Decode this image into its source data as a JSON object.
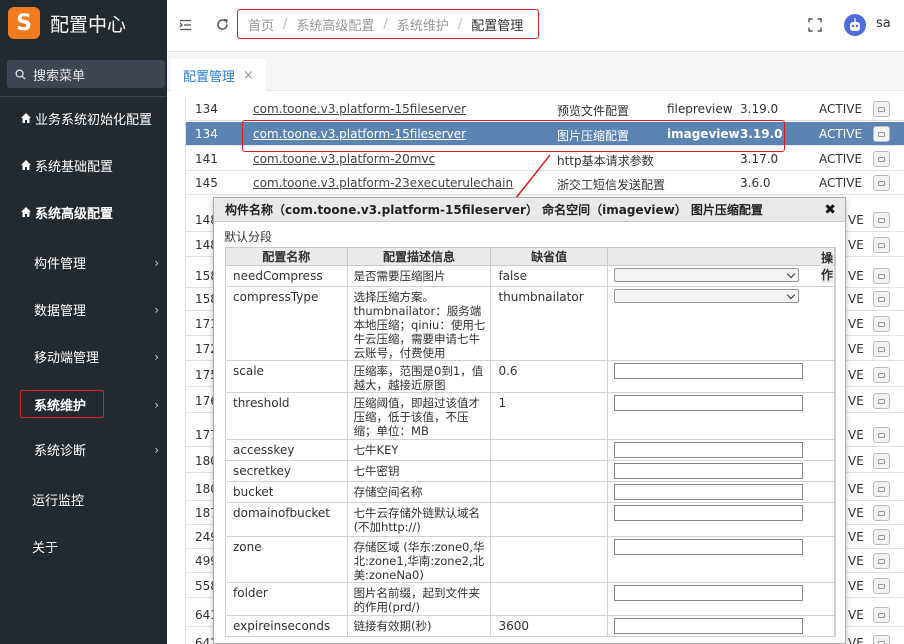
{
  "app": {
    "logo_letter": "S",
    "title": "配置中心",
    "user": "sa"
  },
  "sidebar": {
    "search_label": "搜索菜单",
    "items": [
      {
        "label": "业务系统初始化配置"
      },
      {
        "label": "系统基础配置"
      },
      {
        "label": "系统高级配置"
      },
      {
        "label": "构件管理"
      },
      {
        "label": "数据管理"
      },
      {
        "label": "移动端管理"
      },
      {
        "label": "系统维护"
      },
      {
        "label": "系统诊断"
      },
      {
        "label": "运行监控"
      },
      {
        "label": "关于"
      }
    ]
  },
  "breadcrumb": [
    "首页",
    "系统高级配置",
    "系统维护",
    "配置管理"
  ],
  "tabs": [
    {
      "label": "配置管理",
      "close": "×"
    }
  ],
  "table": {
    "rows": [
      {
        "id": "134",
        "name": "com.toone.v3.platform-15fileserver",
        "desc": "预览文件配置",
        "ns": "filepreview",
        "ver": "3.19.0",
        "status": "ACTIVE"
      },
      {
        "id": "134",
        "name": "com.toone.v3.platform-15fileserver",
        "desc": "图片压缩配置",
        "ns": "imageview",
        "ver": "3.19.0",
        "status": "ACTIVE"
      },
      {
        "id": "141",
        "name": "com.toone.v3.platform-20mvc",
        "desc": "http基本请求参数",
        "ns": "",
        "ver": "3.17.0",
        "status": "ACTIVE"
      },
      {
        "id": "145",
        "name": "com.toone.v3.platform-23executerulechain",
        "desc": "浙交工短信发送配置",
        "ns": "",
        "ver": "3.6.0",
        "status": "ACTIVE"
      }
    ],
    "partial_rows": [
      {
        "id": "148",
        "status": "VE"
      },
      {
        "id": "148",
        "status": "VE"
      },
      {
        "id": "158",
        "status": "VE"
      },
      {
        "id": "158",
        "status": "VE"
      },
      {
        "id": "171",
        "status": "VE"
      },
      {
        "id": "172",
        "status": "VE"
      },
      {
        "id": "175",
        "status": "VE"
      },
      {
        "id": "176",
        "status": "VE"
      },
      {
        "id": "177",
        "status": "VE"
      },
      {
        "id": "180",
        "status": "VE"
      },
      {
        "id": "180",
        "status": "VE"
      },
      {
        "id": "187",
        "status": "VE"
      },
      {
        "id": "249",
        "status": "VE"
      },
      {
        "id": "499",
        "status": "VE"
      },
      {
        "id": "558",
        "status": "VE"
      },
      {
        "id": "641",
        "status": "VE"
      },
      {
        "id": "642",
        "status": "VE"
      }
    ]
  },
  "dialog": {
    "title": "构件名称（com.toone.v3.platform-15fileserver） 命名空间（imageview） 图片压缩配置",
    "close": "✖",
    "section": "默认分段",
    "headers": [
      "配置名称",
      "配置描述信息",
      "缺省值",
      "",
      "操作"
    ],
    "rows": [
      {
        "name": "needCompress",
        "desc": "是否需要压缩图片",
        "default": "false",
        "input": "select"
      },
      {
        "name": "compressType",
        "desc": "选择压缩方案。thumbnailator：服务端本地压缩；qiniu：使用七牛云压缩，需要申请七牛云账号，付费使用",
        "default": "thumbnailator",
        "input": "select"
      },
      {
        "name": "scale",
        "desc": "压缩率，范围是0到1，值越大，越接近原图",
        "default": "0.6",
        "input": "text"
      },
      {
        "name": "threshold",
        "desc": "压缩阈值，即超过该值才压缩，低于该值，不压缩；单位：MB",
        "default": "1",
        "input": "text"
      },
      {
        "name": "accesskey",
        "desc": "七牛KEY",
        "default": "",
        "input": "text"
      },
      {
        "name": "secretkey",
        "desc": "七牛密钥",
        "default": "",
        "input": "text"
      },
      {
        "name": "bucket",
        "desc": "存储空间名称",
        "default": "",
        "input": "text"
      },
      {
        "name": "domainofbucket",
        "desc": "七牛云存储外链默认域名(不加http://)",
        "default": "",
        "input": "text"
      },
      {
        "name": "zone",
        "desc": "存储区域 (华东:zone0,华北:zone1,华南:zone2,北美:zoneNa0)",
        "default": "",
        "input": "text"
      },
      {
        "name": "folder",
        "desc": "图片名前缀，起到文件夹的作用(prd/)",
        "default": "",
        "input": "text"
      },
      {
        "name": "expireinseconds",
        "desc": "链接有效期(秒)",
        "default": "3600",
        "input": "text"
      }
    ]
  },
  "colors": {
    "sidebar": "#22292f",
    "accent": "#2a7bd4",
    "selected_row": "#5c84b3",
    "highlight": "#e02020",
    "logo": "#f07c1e"
  },
  "icons": [
    "search-icon",
    "home-icon",
    "chevron-right-icon",
    "menu-fold-icon",
    "refresh-icon",
    "fullscreen-icon",
    "avatar-icon",
    "edit-icon",
    "close-icon"
  ]
}
